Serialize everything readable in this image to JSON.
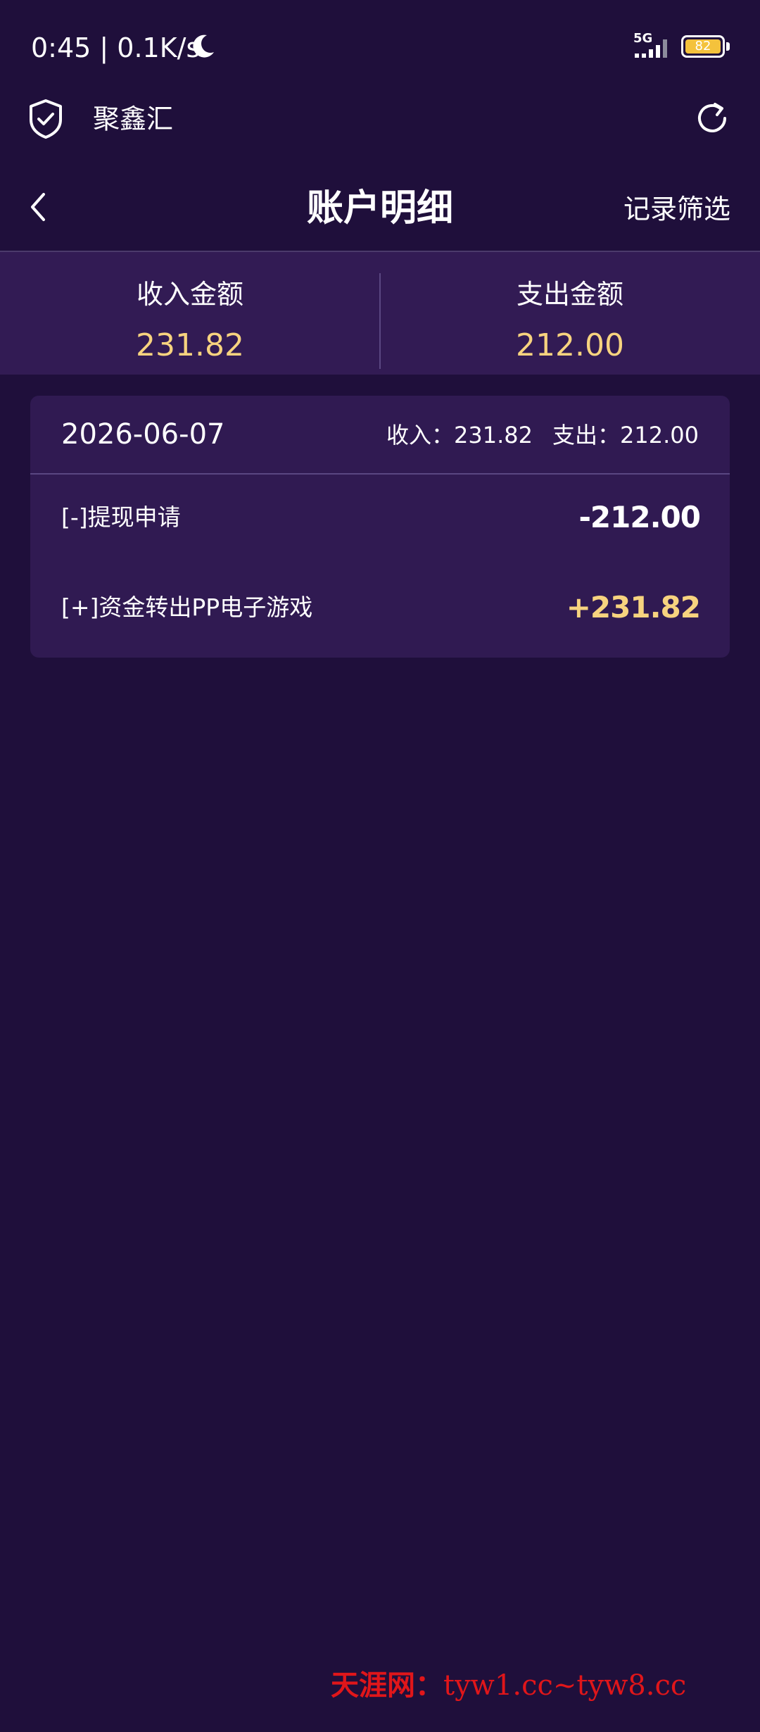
{
  "status_bar": {
    "time_speed": "0:45 | 0.1K/s",
    "network": "5G",
    "battery": "82"
  },
  "app_bar": {
    "name": "聚鑫汇"
  },
  "nav": {
    "title": "账户明细",
    "filter_label": "记录筛选"
  },
  "summary": {
    "income_label": "收入金额",
    "income_value": "231.82",
    "expense_label": "支出金额",
    "expense_value": "212.00"
  },
  "day_group": {
    "date": "2026-06-07",
    "income_text": "收入：231.82",
    "expense_text": "支出：212.00",
    "transactions": [
      {
        "desc": "[-]提现申请",
        "amount": "-212.00"
      },
      {
        "desc": "[+]资金转出PP电子游戏",
        "amount": "+231.82"
      }
    ]
  },
  "watermark": {
    "name": "天涯网：",
    "url": "tyw1.cc~tyw8.cc"
  },
  "colors": {
    "background": "#1f0f3b",
    "panel": "#321b54",
    "accent_gold": "#f7d37f",
    "battery": "#f4c23c",
    "watermark": "#e0161a"
  }
}
